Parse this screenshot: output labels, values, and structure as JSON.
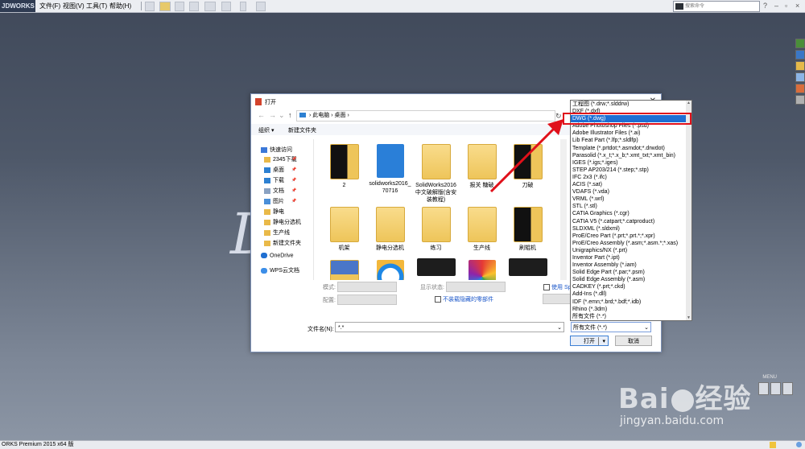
{
  "app": {
    "logo_text": "JDWORKS",
    "menus": [
      "文件(F)",
      "视图(V)",
      "工具(T)",
      "帮助(H)"
    ],
    "search_placeholder": "搜索命令",
    "status_text": "ORKS Premium 2015 x64 版",
    "menu_tag": "MENU",
    "bg_glyph": "Ds"
  },
  "dialog": {
    "title": "打开",
    "breadcrumb": [
      "此电脑",
      "桌面"
    ],
    "toolbar": {
      "organize": "组织 ▾",
      "new_folder": "新建文件夹"
    },
    "nav": [
      {
        "label": "快速访问",
        "icon": "star-icon",
        "color": "#3b78d8",
        "pinned": false
      },
      {
        "label": "2345下载",
        "icon": "folder-icon",
        "color": "#e9b949",
        "pinned": true
      },
      {
        "label": "桌面",
        "icon": "desktop-icon",
        "color": "#2d80d2",
        "pinned": true
      },
      {
        "label": "下载",
        "icon": "download-icon",
        "color": "#2d80d2",
        "pinned": true
      },
      {
        "label": "文档",
        "icon": "document-icon",
        "color": "#8aa2c2",
        "pinned": true
      },
      {
        "label": "图片",
        "icon": "picture-icon",
        "color": "#4a8fd8",
        "pinned": true
      },
      {
        "label": "静电",
        "icon": "folder-icon",
        "color": "#e9b949",
        "pinned": false
      },
      {
        "label": "静电分选机",
        "icon": "folder-icon",
        "color": "#e9b949",
        "pinned": false
      },
      {
        "label": "生产线",
        "icon": "folder-icon",
        "color": "#e9b949",
        "pinned": false
      },
      {
        "label": "新建文件夹",
        "icon": "folder-icon",
        "color": "#e9b949",
        "pinned": false
      },
      {
        "label": "OneDrive",
        "icon": "cloud-icon",
        "color": "#1f6fd1",
        "pinned": false
      },
      {
        "label": "WPS云文档",
        "icon": "cloud-icon",
        "color": "#3c8ee8",
        "pinned": false
      }
    ],
    "files": [
      {
        "label": "2",
        "kind": "folder-dark"
      },
      {
        "label": "solidworks2016_70716",
        "kind": "exe-blue"
      },
      {
        "label": "SolidWorks2016中文破解版(含安装教程)",
        "kind": "folder"
      },
      {
        "label": "报关  糖破",
        "kind": "folder"
      },
      {
        "label": "刀破",
        "kind": "folder-dark"
      },
      {
        "label": "机架",
        "kind": "folder"
      },
      {
        "label": "静电分选机",
        "kind": "folder"
      },
      {
        "label": "练习",
        "kind": "folder"
      },
      {
        "label": "生产线",
        "kind": "folder"
      },
      {
        "label": "刷辊机",
        "kind": "folder-dark"
      },
      {
        "label": "",
        "kind": "folder"
      },
      {
        "label": "",
        "kind": "thumb-circle"
      },
      {
        "label": "",
        "kind": "thumb-dark"
      },
      {
        "label": "",
        "kind": "thumb-colorful"
      },
      {
        "label": "",
        "kind": "thumb-dark"
      }
    ],
    "options": {
      "mode_label": "模式:",
      "config_label": "配置:",
      "display_state_label": "显示状态:",
      "use_speedpak": "使用 Spe",
      "hide_components": "不装载隐藏的零部件"
    },
    "filename_label": "文件名(N):",
    "filename_value": "*.*",
    "filetype_value": "所有文件 (*.*)",
    "open_label": "打开",
    "cancel_label": "取消"
  },
  "file_types": [
    "工程图 (*.drw;*.slddrw)",
    "DXF (*.dxf)",
    "DWG (*.dwg)",
    "Adobe Photoshop Files (*.psd)",
    "Adobe Illustrator Files (*.ai)",
    "Lib Feat Part (*.lfp;*.sldlfp)",
    "Template (*.prtdot;*.asmdot;*.drwdot)",
    "Parasolid (*.x_t;*.x_b;*.xmt_txt;*.xmt_bin)",
    "IGES (*.igs;*.iges)",
    "STEP AP203/214 (*.step;*.stp)",
    "IFC 2x3 (*.ifc)",
    "ACIS (*.sat)",
    "VDAFS (*.vda)",
    "VRML (*.wrl)",
    "STL (*.stl)",
    "CATIA Graphics (*.cgr)",
    "CATIA V5 (*.catpart;*.catproduct)",
    "SLDXML (*.sldxml)",
    "ProE/Creo Part (*.prt;*.prt.*;*.xpr)",
    "ProE/Creo Assembly (*.asm;*.asm.*;*.xas)",
    "Unigraphics/NX (*.prt)",
    "Inventor Part (*.ipt)",
    "Inventor Assembly (*.iam)",
    "Solid Edge Part (*.par;*.psm)",
    "Solid Edge Assembly (*.asm)",
    "CADKEY (*.prt;*.ckd)",
    "Add-Ins (*.dll)",
    "IDF (*.emn;*.brd;*.bdf;*.idb)",
    "Rhino (*.3dm)",
    "所有文件 (*.*)"
  ],
  "selected_type_index": 2,
  "watermark": {
    "logo": "Bai  经验",
    "url": "jingyan.baidu.com"
  },
  "colors": {
    "selection": "#1e6fd3",
    "annotation": "#e0101a"
  }
}
